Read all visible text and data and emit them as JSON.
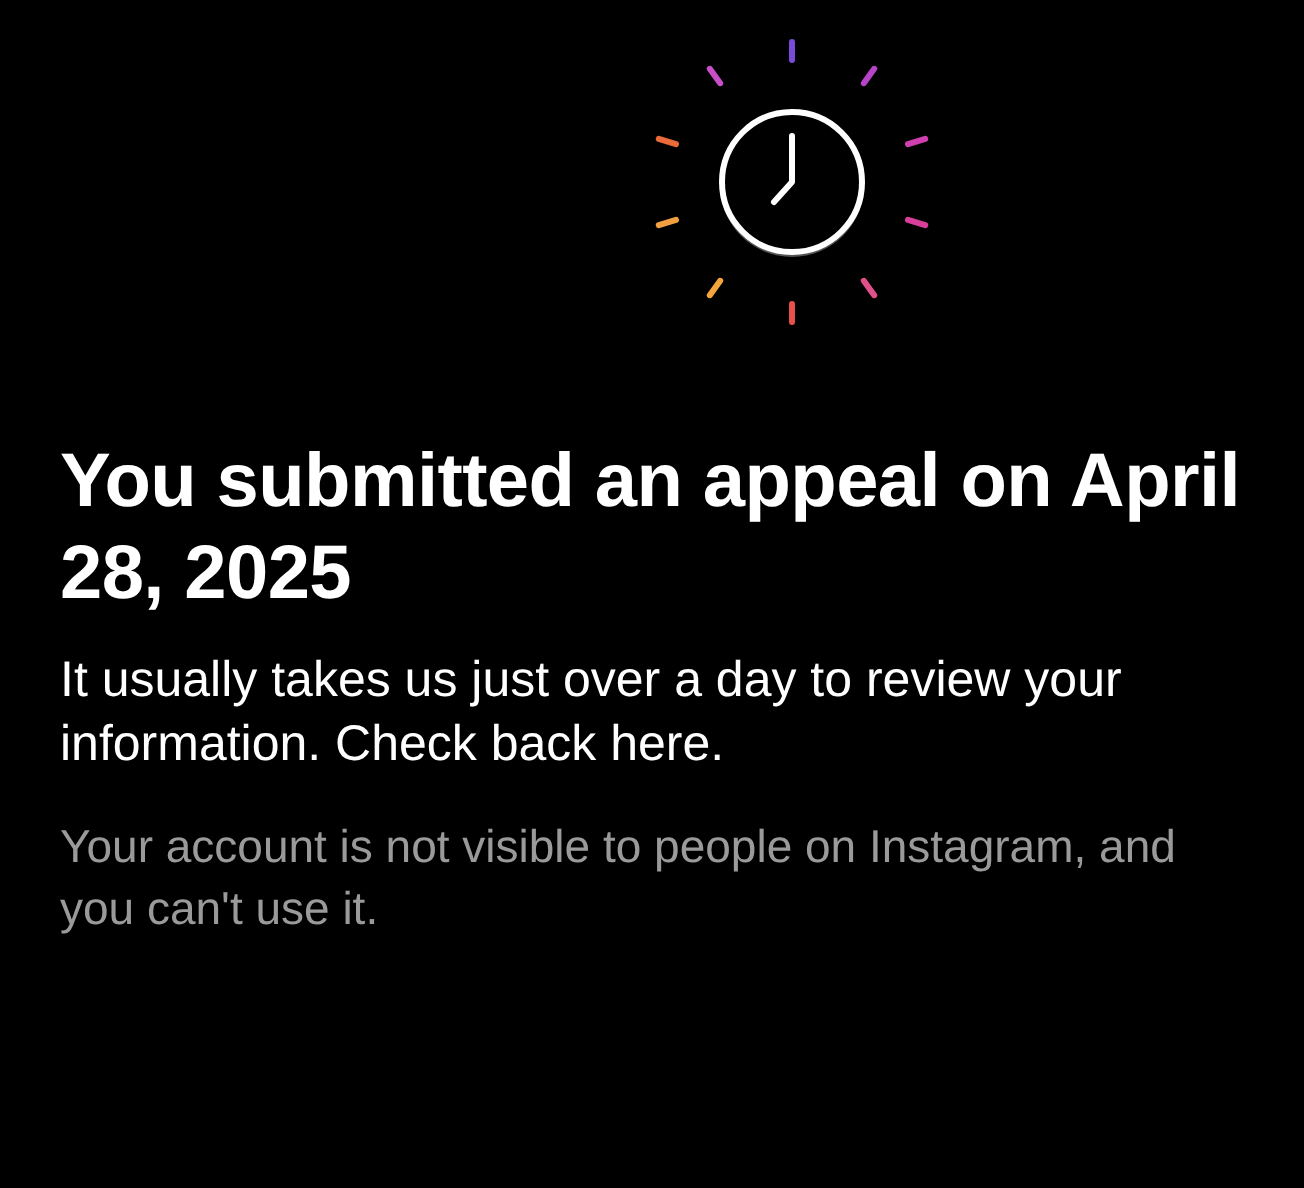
{
  "title": "You submitted an appeal on April 28, 2025",
  "message": "It usually takes us just over a day to review your information. Check back here.",
  "note": "Your account is not visible to people on Instagram, and you can't use it."
}
